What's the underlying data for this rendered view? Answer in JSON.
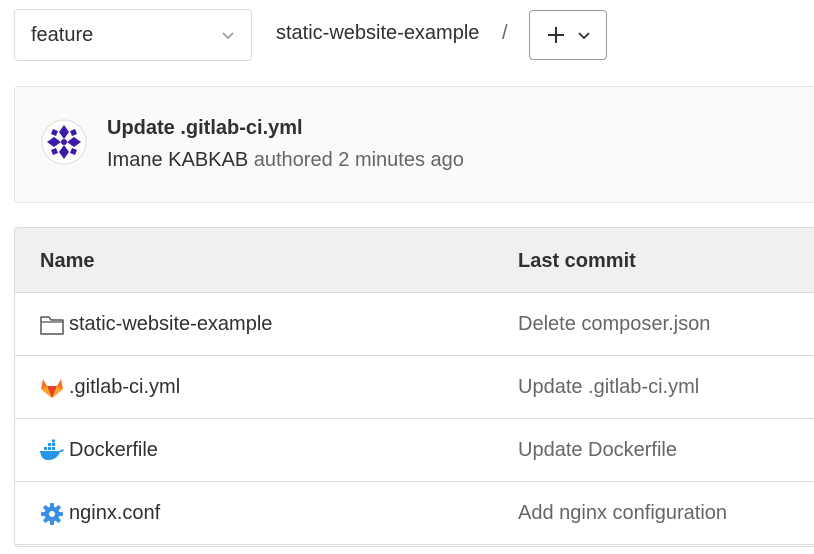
{
  "branch_selector": {
    "value": "feature",
    "icon": "chevron-down-icon"
  },
  "breadcrumb": {
    "repo": "static-website-example",
    "separator": "/"
  },
  "add_button": {
    "icon": "plus-icon",
    "dropdown_icon": "chevron-down-icon"
  },
  "latest_commit": {
    "title": "Update .gitlab-ci.yml",
    "author": "Imane KABKAB",
    "meta": "authored 2 minutes ago"
  },
  "file_table": {
    "columns": [
      "Name",
      "Last commit"
    ],
    "rows": [
      {
        "name": "static-website-example",
        "icon": "folder-icon",
        "last_commit": "Delete composer.json"
      },
      {
        "name": ".gitlab-ci.yml",
        "icon": "gitlab-icon",
        "last_commit": "Update .gitlab-ci.yml"
      },
      {
        "name": "Dockerfile",
        "icon": "docker-icon",
        "last_commit": "Update Dockerfile"
      },
      {
        "name": "nginx.conf",
        "icon": "gear-icon",
        "last_commit": "Add nginx configuration"
      }
    ]
  },
  "colors": {
    "gitlab_orange": "#e24329",
    "docker_blue": "#2496ed",
    "gear_blue": "#3a8ee6",
    "avatar_purple": "#3d1aa8"
  }
}
